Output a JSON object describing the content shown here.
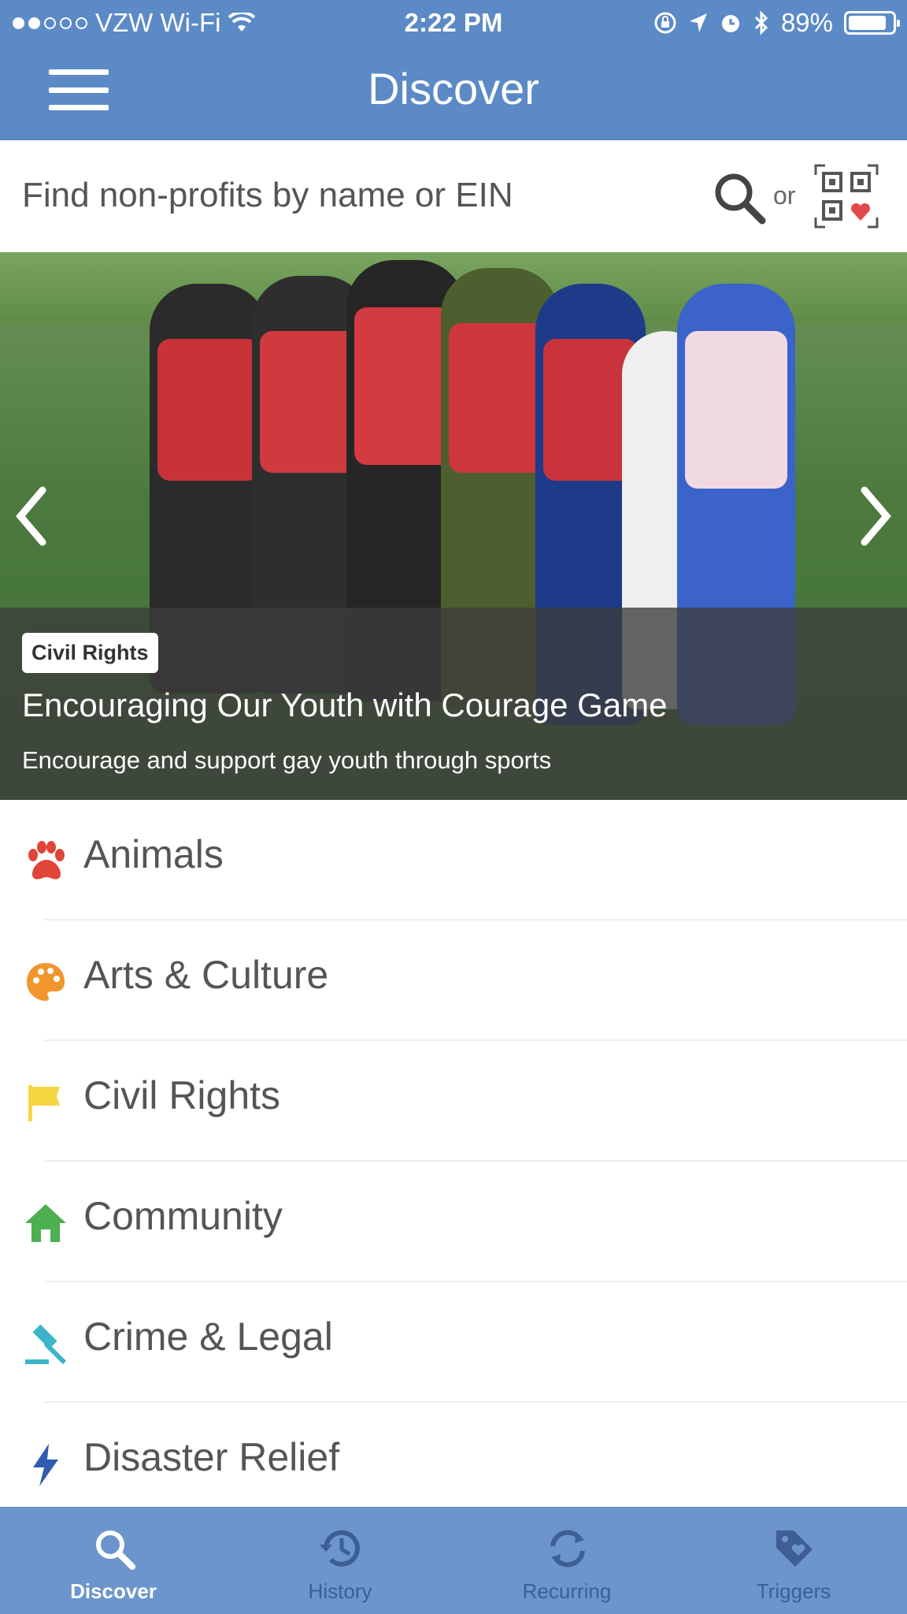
{
  "status": {
    "carrier": "VZW Wi-Fi",
    "time": "2:22 PM",
    "battery": "89%",
    "battery_level": 0.89
  },
  "header": {
    "title": "Discover"
  },
  "search": {
    "placeholder": "Find non-profits by name or EIN",
    "or_text": "or"
  },
  "hero": {
    "tag": "Civil Rights",
    "title": "Encouraging Our Youth with Courage Game",
    "subtitle": "Encourage and support gay youth through sports"
  },
  "categories": [
    {
      "label": "Animals",
      "icon": "paw-icon",
      "color": "#e0453a"
    },
    {
      "label": "Arts & Culture",
      "icon": "palette-icon",
      "color": "#f0962c"
    },
    {
      "label": "Civil Rights",
      "icon": "flag-icon",
      "color": "#f6d743"
    },
    {
      "label": "Community",
      "icon": "home-icon",
      "color": "#4caf50"
    },
    {
      "label": "Crime & Legal",
      "icon": "gavel-icon",
      "color": "#3cb5c8"
    },
    {
      "label": "Disaster Relief",
      "icon": "lightning-icon",
      "color": "#2f5cae"
    }
  ],
  "tabs": [
    {
      "label": "Discover",
      "icon": "search-icon",
      "active": true
    },
    {
      "label": "History",
      "icon": "history-icon",
      "active": false
    },
    {
      "label": "Recurring",
      "icon": "refresh-icon",
      "active": false
    },
    {
      "label": "Triggers",
      "icon": "tag-icon",
      "active": false
    }
  ],
  "colors": {
    "header": "#5b8ac6",
    "tabbar": "#6b95cc"
  }
}
